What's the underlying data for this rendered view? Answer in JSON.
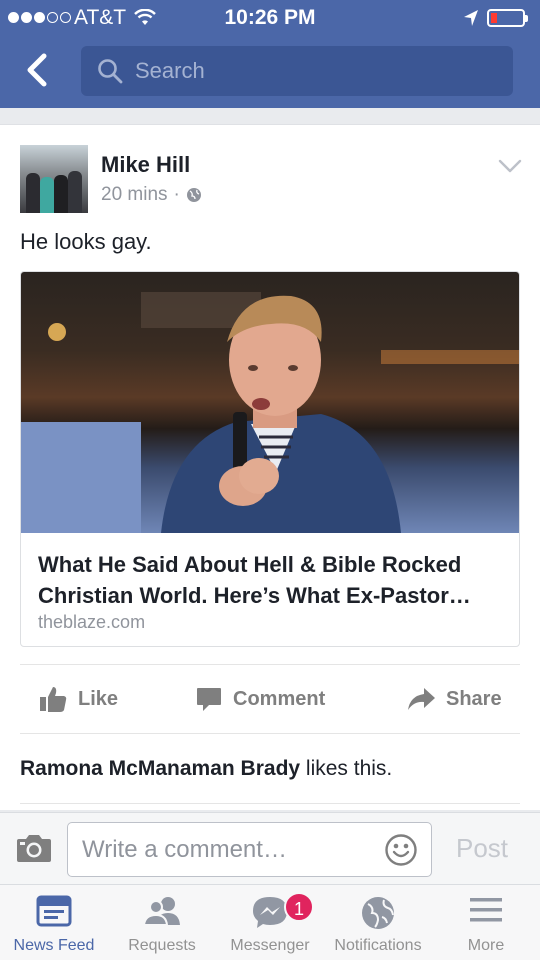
{
  "status_bar": {
    "carrier": "AT&T",
    "time": "10:26 PM",
    "battery_level": 0.1,
    "signal_bars": 3
  },
  "header": {
    "back_icon": "chevron-left-icon",
    "search_placeholder": "Search"
  },
  "post": {
    "author": "Mike Hill",
    "time_ago": "20 mins",
    "separator": "·",
    "privacy_icon": "globe-icon",
    "text": "He looks gay.",
    "link": {
      "title": "What He Said About Hell & Bible Rocked Christian World. Here’s What Ex-Pastor…",
      "domain": "theblaze.com"
    },
    "actions": {
      "like": "Like",
      "comment": "Comment",
      "share": "Share"
    },
    "likes": {
      "name": "Ramona McManaman Brady",
      "suffix": " likes this."
    }
  },
  "comment_bar": {
    "placeholder": "Write a comment…",
    "post_label": "Post"
  },
  "tabs": [
    {
      "label": "News Feed",
      "icon": "news-feed-icon",
      "active": true
    },
    {
      "label": "Requests",
      "icon": "friend-requests-icon"
    },
    {
      "label": "Messenger",
      "icon": "messenger-icon",
      "badge": "1"
    },
    {
      "label": "Notifications",
      "icon": "globe-icon"
    },
    {
      "label": "More",
      "icon": "menu-icon"
    }
  ],
  "colors": {
    "brand_blue": "#4b67a8",
    "search_bg": "#3b5694",
    "badge_red": "#e0245e"
  }
}
